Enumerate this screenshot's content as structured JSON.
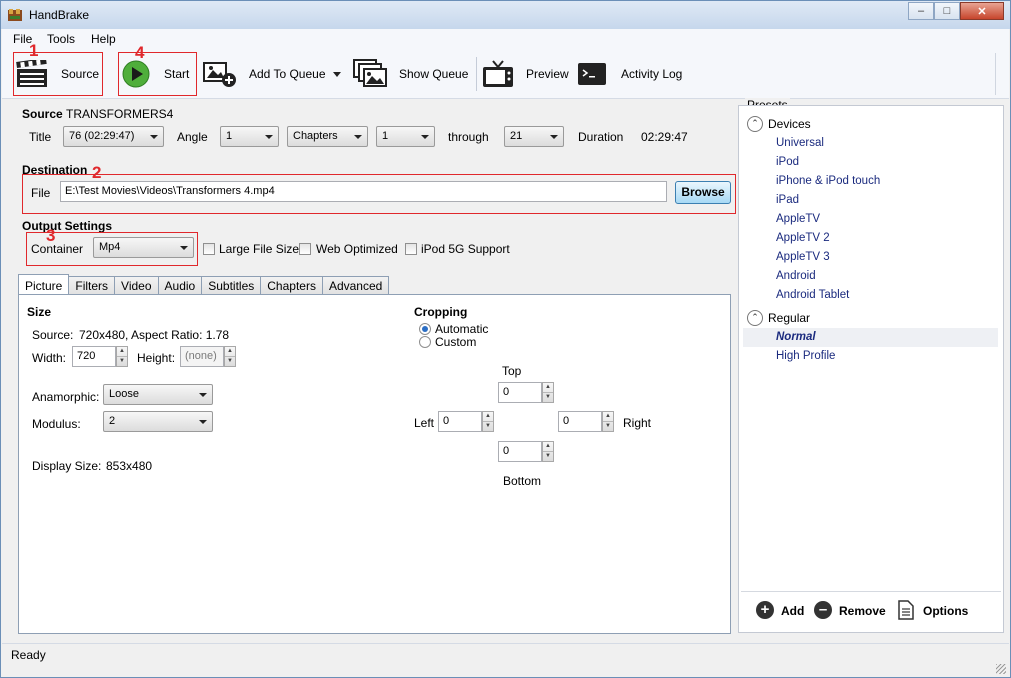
{
  "window": {
    "title": "HandBrake"
  },
  "menu": [
    "File",
    "Tools",
    "Help"
  ],
  "toolbar": {
    "source": "Source",
    "start": "Start",
    "add_to_queue": "Add To Queue",
    "show_queue": "Show Queue",
    "preview": "Preview",
    "activity_log": "Activity Log"
  },
  "annotations": [
    "1",
    "2",
    "3",
    "4"
  ],
  "source": {
    "label": "Source",
    "value": "TRANSFORMERS4",
    "title_label": "Title",
    "title_value": "76 (02:29:47)",
    "angle_label": "Angle",
    "angle_value": "1",
    "range_mode": "Chapters",
    "range_start": "1",
    "through_label": "through",
    "range_end": "21",
    "duration_label": "Duration",
    "duration_value": "02:29:47"
  },
  "destination": {
    "label": "Destination",
    "file_label": "File",
    "file_value": "E:\\Test Movies\\Videos\\Transformers 4.mp4",
    "browse": "Browse"
  },
  "output": {
    "label": "Output Settings",
    "container_label": "Container",
    "container_value": "Mp4",
    "large_file": "Large File Size",
    "web_optimized": "Web Optimized",
    "ipod5g": "iPod 5G Support"
  },
  "tabs": [
    "Picture",
    "Filters",
    "Video",
    "Audio",
    "Subtitles",
    "Chapters",
    "Advanced"
  ],
  "picture": {
    "size_label": "Size",
    "source_label": "Source:",
    "source_value": "720x480, Aspect Ratio: 1.78",
    "width_label": "Width:",
    "width_value": "720",
    "height_label": "Height:",
    "height_placeholder": "(none)",
    "anamorphic_label": "Anamorphic:",
    "anamorphic_value": "Loose",
    "modulus_label": "Modulus:",
    "modulus_value": "2",
    "display_size_label": "Display Size:",
    "display_size_value": "853x480"
  },
  "cropping": {
    "label": "Cropping",
    "automatic": "Automatic",
    "custom": "Custom",
    "top_label": "Top",
    "top": "0",
    "left_label": "Left",
    "left": "0",
    "right_label": "Right",
    "right": "0",
    "bottom_label": "Bottom",
    "bottom": "0"
  },
  "presets": {
    "label": "Presets",
    "groups": [
      {
        "name": "Devices",
        "items": [
          "Universal",
          "iPod",
          "iPhone & iPod touch",
          "iPad",
          "AppleTV",
          "AppleTV 2",
          "AppleTV 3",
          "Android",
          "Android Tablet"
        ]
      },
      {
        "name": "Regular",
        "items": [
          "Normal",
          "High Profile"
        ]
      }
    ],
    "add": "Add",
    "remove": "Remove",
    "options": "Options"
  },
  "status": "Ready",
  "colors": {
    "annotation": "#e0282c",
    "preset_text": "#1a2a7e",
    "selected_row": "#eef0f4"
  }
}
